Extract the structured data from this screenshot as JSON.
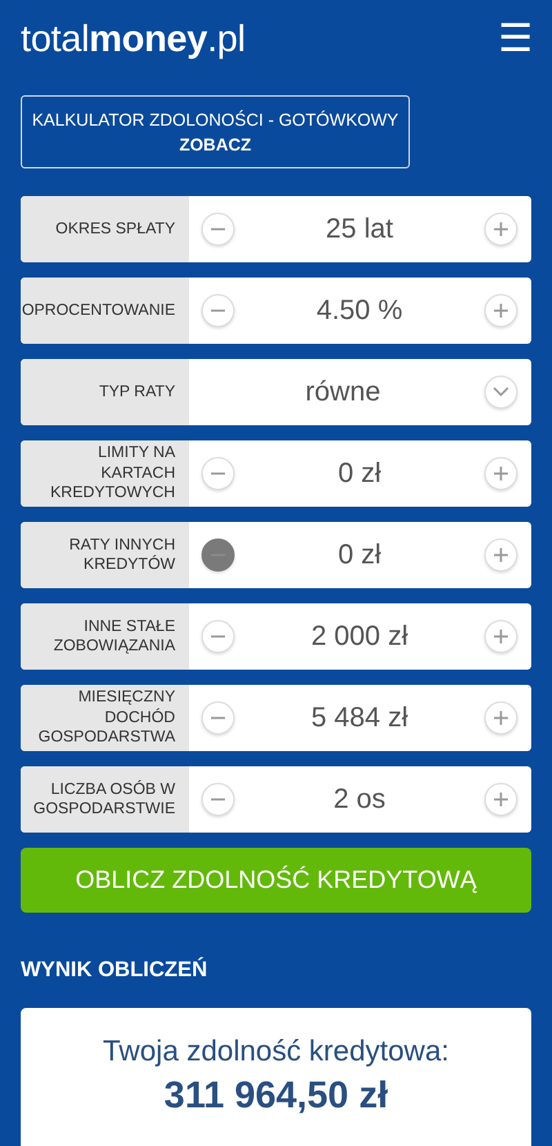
{
  "header": {
    "logo": "total**money**.pl",
    "menu_icon": "☰"
  },
  "promo": {
    "title": "KALKULATOR ZDOLONOŚCI - GOTÓWKOWY",
    "link": "ZOBACZ"
  },
  "fields": [
    {
      "kind": "stepper",
      "label": "OKRES SPŁATY",
      "value": "25 lat",
      "minus_disabled": false
    },
    {
      "kind": "stepper",
      "label": "OPROCENTOWANIE",
      "value": "4.50 %",
      "minus_disabled": false
    },
    {
      "kind": "select",
      "label": "TYP RATY",
      "value": "równe"
    },
    {
      "kind": "stepper",
      "label": "LIMITY NA KARTACH KREDYTOWYCH",
      "value": "0 zł",
      "minus_disabled": false
    },
    {
      "kind": "stepper",
      "label": "RATY INNYCH KREDYTÓW",
      "value": "0 zł",
      "minus_disabled": true
    },
    {
      "kind": "stepper",
      "label": "INNE STAŁE ZOBOWIĄZANIA",
      "value": "2 000 zł",
      "minus_disabled": false
    },
    {
      "kind": "stepper",
      "label": "MIESIĘCZNY DOCHÓD GOSPODARSTWA",
      "value": "5 484 zł",
      "minus_disabled": false
    },
    {
      "kind": "stepper",
      "label": "LICZBA OSÓB W GOSPODARSTWIE",
      "value": "2 os",
      "minus_disabled": false
    }
  ],
  "submit": "OBLICZ ZDOLNOŚĆ KREDYTOWĄ",
  "result": {
    "heading": "WYNIK OBLICZEŃ",
    "caption": "Twoja zdolność kredytowa:",
    "amount": "311 964,50 zł"
  }
}
